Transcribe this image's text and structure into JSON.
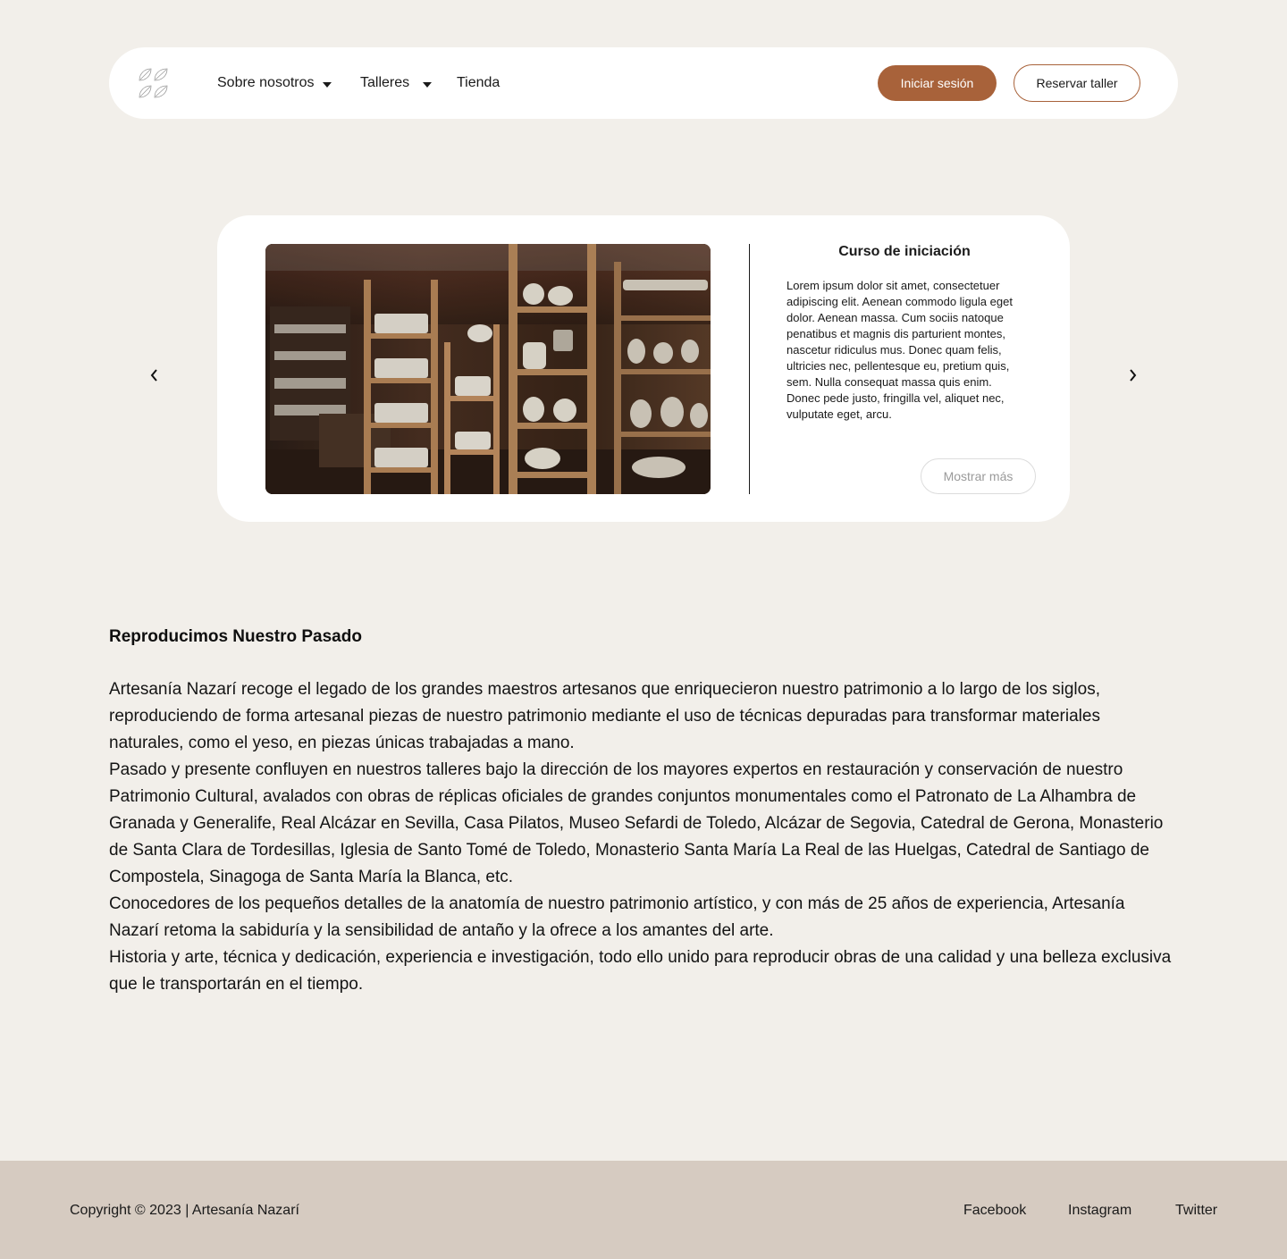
{
  "header": {
    "logo": "leaf-logo",
    "nav": [
      {
        "label": "Sobre nosotros",
        "has_dropdown": true
      },
      {
        "label": "Talleres",
        "has_dropdown": true
      },
      {
        "label": "Tienda",
        "has_dropdown": false
      }
    ],
    "login_label": "Iniciar sesión",
    "book_label": "Reservar taller"
  },
  "carousel": {
    "image_alt": "pottery-workshop-shelves-photo",
    "title": "Curso de iniciación",
    "text": "Lorem ipsum dolor sit amet, consectetuer adipiscing elit. Aenean commodo ligula eget dolor. Aenean massa. Cum sociis natoque penatibus et magnis dis parturient montes, nascetur ridiculus mus. Donec quam felis, ultricies nec, pellentesque eu, pretium quis, sem. Nulla consequat massa quis enim. Donec pede justo, fringilla vel, aliquet nec, vulputate eget, arcu.",
    "more_label": "Mostrar más",
    "prev_icon": "chevron-left-icon",
    "next_icon": "chevron-right-icon"
  },
  "about": {
    "title": "Reproducimos Nuestro Pasado",
    "paragraphs": [
      "Artesanía Nazarí recoge el legado de los grandes maestros artesanos que enriquecieron nuestro patrimonio a lo largo de los siglos, reproduciendo de forma artesanal piezas de nuestro patrimonio mediante el uso de técnicas depuradas para transformar materiales naturales, como el yeso, en piezas únicas trabajadas a mano.",
      "Pasado y presente confluyen en nuestros talleres bajo la dirección de los mayores expertos en restauración y conservación de nuestro Patrimonio Cultural, avalados con obras de réplicas oficiales de grandes conjuntos monumentales como el Patronato de La Alhambra de Granada y Generalife, Real Alcázar en Sevilla, Casa Pilatos, Museo Sefardi de Toledo, Alcázar de Segovia, Catedral de Gerona, Monasterio de Santa Clara de Tordesillas, Iglesia de Santo Tomé de Toledo, Monasterio Santa María La Real de las Huelgas, Catedral de Santiago de Compostela, Sinagoga de Santa María la Blanca, etc.",
      "Conocedores de los pequeños detalles de la anatomía de nuestro patrimonio artístico, y con más de 25 años de experiencia, Artesanía Nazarí retoma la sabiduría y la sensibilidad de antaño y la ofrece a los amantes del arte.",
      "Historia y arte, técnica y dedicación, experiencia e investigación, todo ello unido para reproducir obras de una calidad y una belleza exclusiva que le transportarán en el tiempo."
    ]
  },
  "footer": {
    "copyright": "Copyright © 2023 | Artesanía Nazarí",
    "links": [
      "Facebook",
      "Instagram",
      "Twitter"
    ]
  },
  "colors": {
    "page_background": "#f2efea",
    "accent": "#a8623a",
    "footer_background": "#d6cbc1",
    "surface": "#ffffff"
  }
}
